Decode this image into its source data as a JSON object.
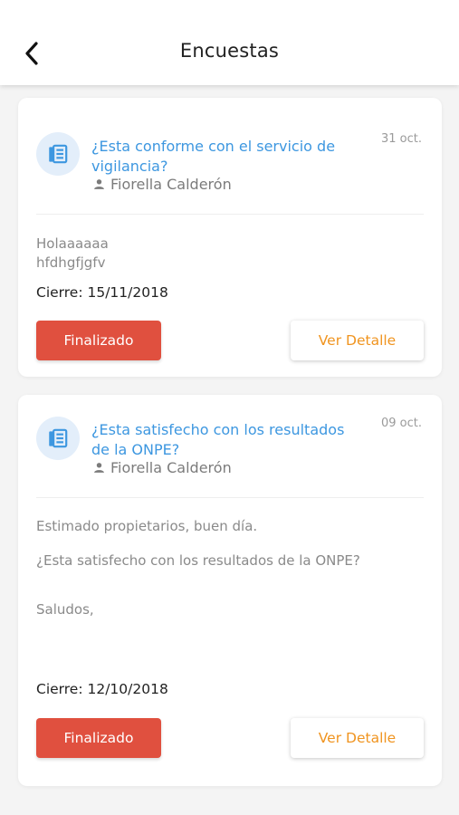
{
  "header": {
    "title": "Encuestas",
    "back_icon": "chevron-left-icon"
  },
  "colors": {
    "link": "#3d97e0",
    "danger": "#e0503f",
    "accent": "#f0941f",
    "avatar_bg": "#e3eefa"
  },
  "surveys": [
    {
      "icon": "newspaper-icon",
      "title": "¿Esta conforme con el servicio de vigilancia?",
      "date": "31 oct.",
      "author_icon": "person-icon",
      "author": "Fiorella Calderón",
      "body_lines": [
        "Holaaaaaa",
        "hfdhgfjgfv"
      ],
      "close": "Cierre: 15/11/2018",
      "status_label": "Finalizado",
      "detail_label": "Ver Detalle"
    },
    {
      "icon": "newspaper-icon",
      "title": "¿Esta satisfecho con los resultados de la ONPE?",
      "date": "09 oct.",
      "author_icon": "person-icon",
      "author": "Fiorella Calderón",
      "body_lines": [
        "Estimado propietarios, buen día.",
        "¿Esta satisfecho con los resultados de la ONPE?",
        "Saludos,"
      ],
      "close": "Cierre: 12/10/2018",
      "status_label": "Finalizado",
      "detail_label": "Ver Detalle"
    }
  ]
}
